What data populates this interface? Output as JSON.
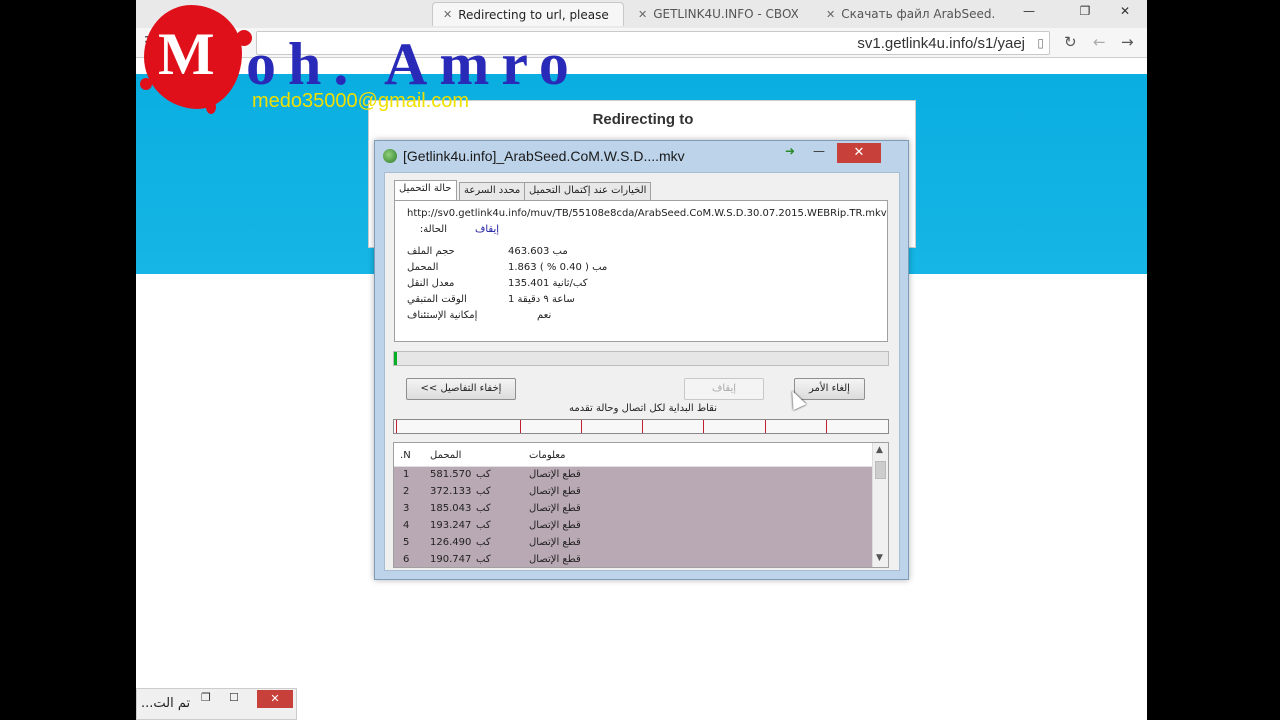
{
  "browser": {
    "tabs": [
      {
        "label": "Redirecting to url, please",
        "active": true
      },
      {
        "label": "GETLINK4U.INFO - CBOX",
        "active": false
      },
      {
        "label": "Скачать файл ArabSeed.",
        "active": false
      }
    ],
    "url": "sv1.getlink4u.info/s1/yaej",
    "window_controls": {
      "minimize": "—",
      "restore": "❐",
      "close": "✕"
    }
  },
  "watermark": {
    "initial": "M",
    "name": "oh. Amro",
    "email": "medo35000@gmail.com"
  },
  "page": {
    "redirect_title": "Redirecting to"
  },
  "download_dialog": {
    "title": "[Getlink4u.info]_ArabSeed.CoM.W.S.D....mkv",
    "tabs": [
      "حالة التحميل",
      "محدد السرعة",
      "الخيارات عند إكتمال التحميل"
    ],
    "url": "http://sv0.getlink4u.info/muv/TB/55108e8cda/ArabSeed.CoM.W.S.D.30.07.2015.WEBRip.TR.mkv",
    "status_label": "الحالة:",
    "status_value": "إيقاف",
    "fields": [
      {
        "label": "حجم الملف",
        "value": "463.603  مب"
      },
      {
        "label": "المحمل",
        "value": "1.863  مب   ( 0.40 % )"
      },
      {
        "label": "معدل النقل",
        "value": "135.401  كب/ثانية"
      },
      {
        "label": "الوقت المتبقي",
        "value": "1 ساعة ٩ دقيقة"
      },
      {
        "label": "إمكانية الإستئناف",
        "value": "نعم"
      }
    ],
    "progress_fraction": 0.004,
    "buttons": {
      "hide_details": "إخفاء التفاصيل >>",
      "pause": "إيقاف",
      "cancel": "إلغاء الأمر"
    },
    "segments_label": "نقاط البداية لكل اتصال وحالة تقدمه",
    "table": {
      "columns": [
        "N.",
        "المحمل",
        "معلومات"
      ],
      "rows": [
        {
          "n": "1",
          "size": "581.570",
          "unit": "كب",
          "info": "قطع الإتصال"
        },
        {
          "n": "2",
          "size": "372.133",
          "unit": "كب",
          "info": "قطع الإتصال"
        },
        {
          "n": "3",
          "size": "185.043",
          "unit": "كب",
          "info": "قطع الإتصال"
        },
        {
          "n": "4",
          "size": "193.247",
          "unit": "كب",
          "info": "قطع الإتصال"
        },
        {
          "n": "5",
          "size": "126.490",
          "unit": "كب",
          "info": "قطع الإتصال"
        },
        {
          "n": "6",
          "size": "190.747",
          "unit": "كب",
          "info": "قطع الإتصال"
        }
      ]
    }
  },
  "minimized_window": {
    "text": "تم الت..."
  },
  "colors": {
    "banner": "#16b6e6",
    "progress": "#06b025",
    "close": "#c7403a",
    "watermark_red": "#e0101a",
    "watermark_blue": "#2a2ab8",
    "watermark_email": "#f0e000"
  }
}
